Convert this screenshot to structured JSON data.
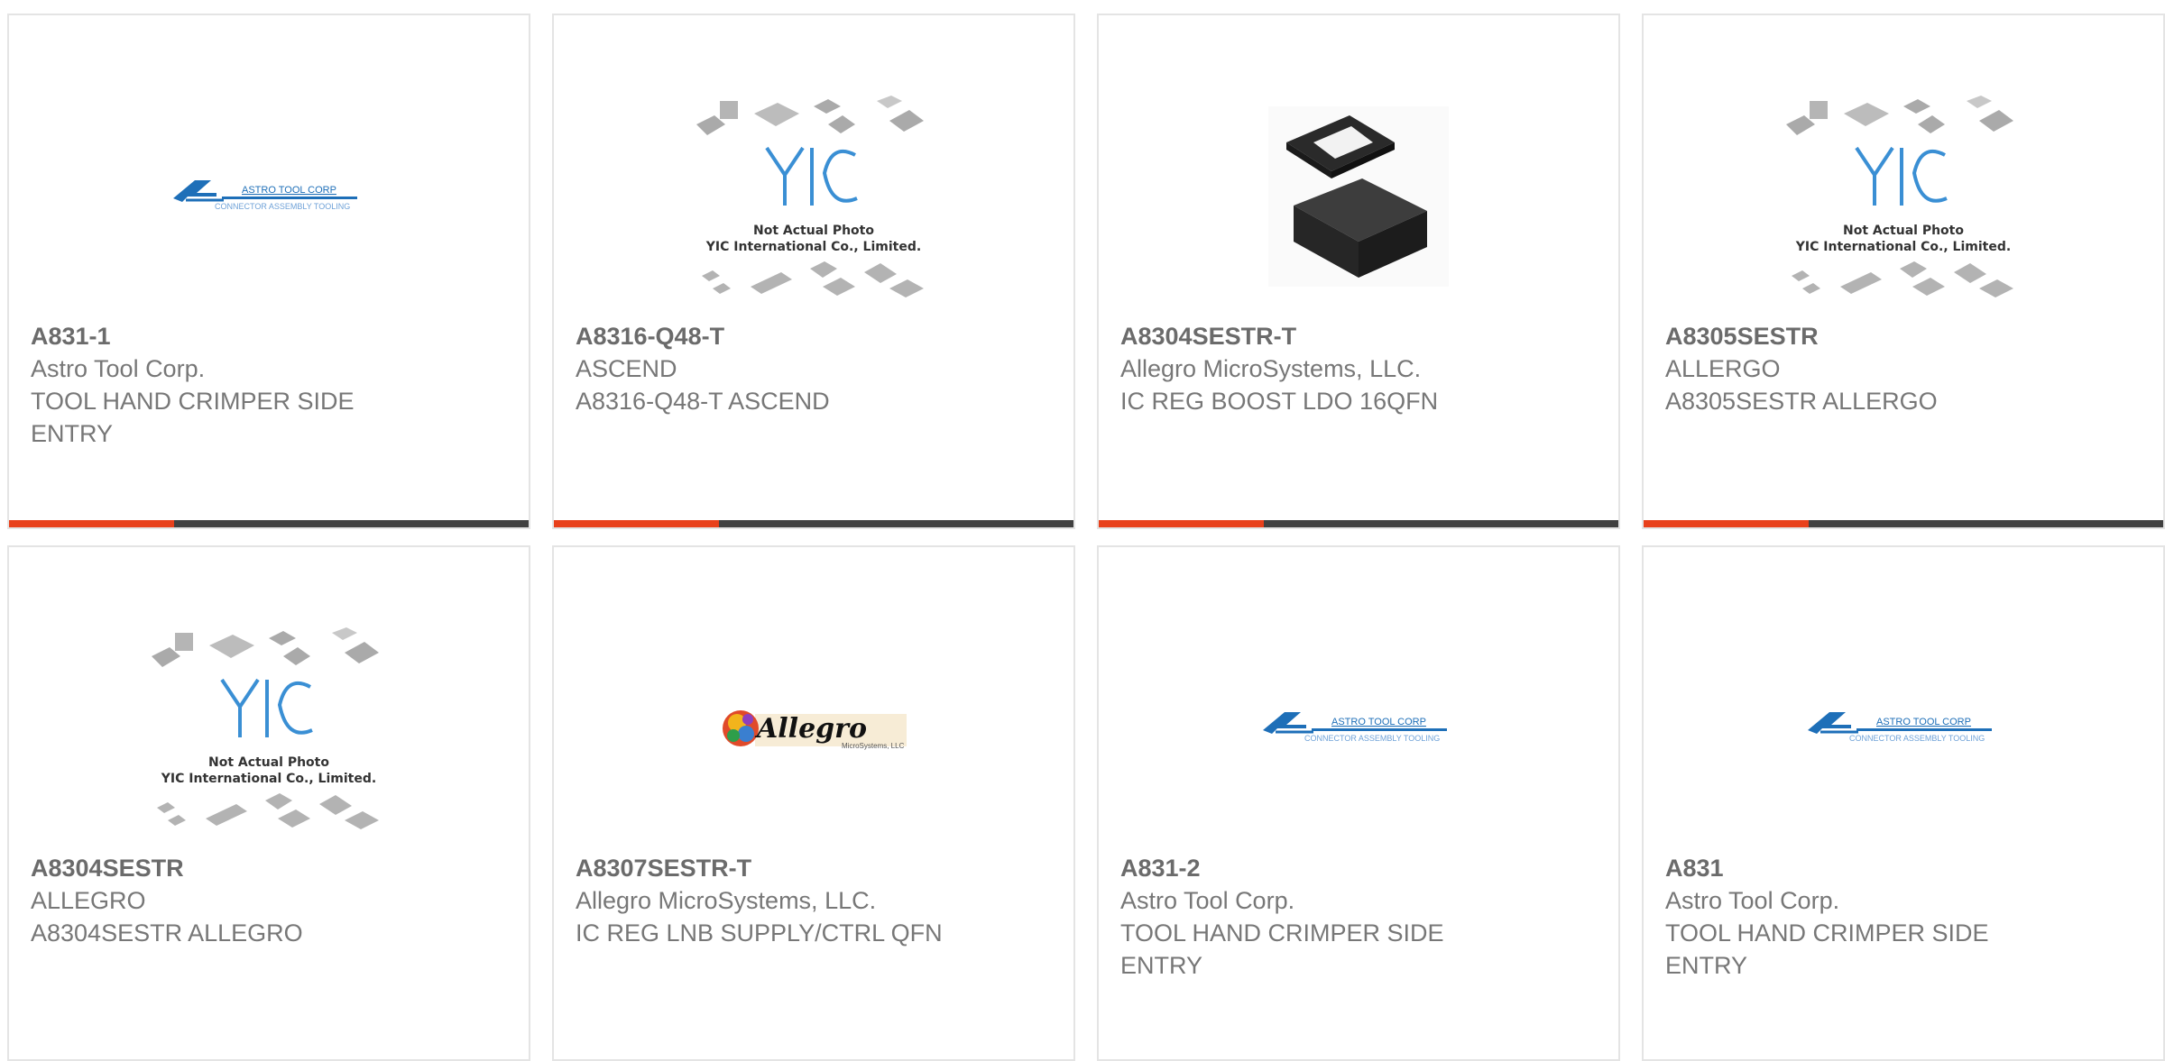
{
  "colors": {
    "accent": "#e8401b",
    "bar": "#404040",
    "border": "#e4e4e4",
    "text": "#777777"
  },
  "products": [
    {
      "part_number": "A831-1",
      "manufacturer": "Astro Tool Corp.",
      "description": "TOOL HAND CRIMPER SIDE ENTRY",
      "image": "astro-tool-logo",
      "logo_text": "ASTRO TOOL CORP",
      "logo_subtext": "CONNECTOR ASSEMBLY TOOLING"
    },
    {
      "part_number": "A8316-Q48-T",
      "manufacturer": "ASCEND",
      "description": "A8316-Q48-T ASCEND",
      "image": "yic-placeholder",
      "logo_text": "YIC",
      "photo_line1": "Not Actual Photo",
      "photo_line2": "YIC International Co., Limited."
    },
    {
      "part_number": "A8304SESTR-T",
      "manufacturer": "Allegro MicroSystems, LLC.",
      "description": "IC REG BOOST LDO 16QFN",
      "image": "qfn-chip-photo"
    },
    {
      "part_number": "A8305SESTR",
      "manufacturer": "ALLERGO",
      "description": "A8305SESTR ALLERGO",
      "image": "yic-placeholder",
      "logo_text": "YIC",
      "photo_line1": "Not Actual Photo",
      "photo_line2": "YIC International Co., Limited."
    },
    {
      "part_number": "A8304SESTR",
      "manufacturer": "ALLEGRO",
      "description": "A8304SESTR ALLEGRO",
      "image": "yic-placeholder",
      "logo_text": "YIC",
      "photo_line1": "Not Actual Photo",
      "photo_line2": "YIC International Co., Limited."
    },
    {
      "part_number": "A8307SESTR-T",
      "manufacturer": "Allegro MicroSystems, LLC.",
      "description": "IC REG LNB SUPPLY/CTRL QFN",
      "image": "allegro-logo",
      "logo_text": "Allegro",
      "logo_subtext": "MicroSystems, LLC"
    },
    {
      "part_number": "A831-2",
      "manufacturer": "Astro Tool Corp.",
      "description": "TOOL HAND CRIMPER SIDE ENTRY",
      "image": "astro-tool-logo",
      "logo_text": "ASTRO TOOL CORP",
      "logo_subtext": "CONNECTOR ASSEMBLY TOOLING"
    },
    {
      "part_number": "A831",
      "manufacturer": "Astro Tool Corp.",
      "description": "TOOL HAND CRIMPER SIDE ENTRY",
      "image": "astro-tool-logo",
      "logo_text": "ASTRO TOOL CORP",
      "logo_subtext": "CONNECTOR ASSEMBLY TOOLING"
    }
  ]
}
